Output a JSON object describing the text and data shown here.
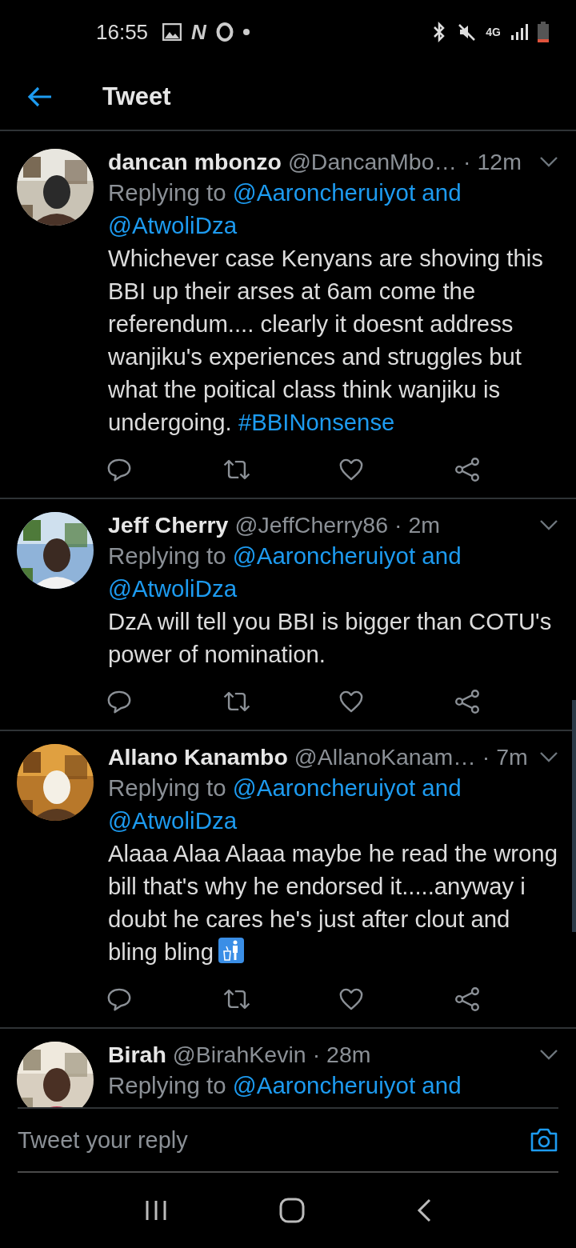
{
  "status_bar": {
    "time": "16:55",
    "app_letter": "N",
    "network": "4G"
  },
  "header": {
    "title": "Tweet"
  },
  "tweets": [
    {
      "name": "dancan mbonzo",
      "handle": "@DancanMbo…",
      "time": "· 12m",
      "replying_prefix": "Replying to",
      "mentions": [
        "@Aaroncheruiyot and",
        "@AtwoliDza"
      ],
      "body": "Whichever case Kenyans are shoving this BBI up their arses at 6am come the referendum.... clearly it doesnt address wanjiku's experiences and struggles but what the poitical class think wanjiku is undergoing.",
      "hashtag": "#BBINonsense"
    },
    {
      "name": "Jeff Cherry",
      "handle": "@JeffCherry86",
      "time": "· 2m",
      "replying_prefix": "Replying to",
      "mentions": [
        "@Aaroncheruiyot and",
        "@AtwoliDza"
      ],
      "body": "DzA will tell you BBI is bigger than COTU's power of nomination."
    },
    {
      "name": "Allano Kanambo",
      "handle": "@AllanoKanam…",
      "time": "· 7m",
      "replying_prefix": "Replying to",
      "mentions": [
        "@Aaroncheruiyot and",
        "@AtwoliDza"
      ],
      "body": "Alaaa Alaa Alaaa maybe he read the wrong bill that's why he endorsed it.....anyway i doubt he cares he's just after clout and bling bling",
      "emoji_icon": true
    },
    {
      "name": "Birah",
      "handle": "@BirahKevin",
      "time": "· 28m",
      "replying_prefix": "Replying to",
      "mentions": [
        "@Aaroncheruiyot and"
      ]
    }
  ],
  "reply_bar": {
    "placeholder": "Tweet your reply"
  }
}
